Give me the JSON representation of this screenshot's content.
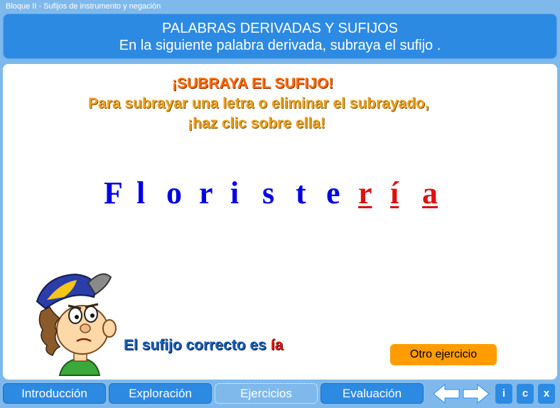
{
  "window": {
    "title": "Bloque II - Sufijos de instrumento y negación"
  },
  "header": {
    "title": "PALABRAS DERIVADAS Y SUFIJOS",
    "subtitle": "En la siguiente palabra derivada, subraya el sufijo ."
  },
  "instructions": {
    "heading": "¡SUBRAYA EL SUFIJO!",
    "line1": "Para subrayar una letra o eliminar el subrayado,",
    "line2": "¡haz clic sobre ella!"
  },
  "word": {
    "letters": [
      {
        "char": "F",
        "selected": false
      },
      {
        "char": "l",
        "selected": false
      },
      {
        "char": "o",
        "selected": false
      },
      {
        "char": "r",
        "selected": false
      },
      {
        "char": "i",
        "selected": false
      },
      {
        "char": "s",
        "selected": false
      },
      {
        "char": "t",
        "selected": false
      },
      {
        "char": "e",
        "selected": false
      },
      {
        "char": "r",
        "selected": true
      },
      {
        "char": "í",
        "selected": true
      },
      {
        "char": "a",
        "selected": true
      }
    ]
  },
  "result": {
    "label": "El sufijo correcto es",
    "suffix": "ía"
  },
  "buttons": {
    "otro": "Otro ejercicio"
  },
  "nav": {
    "tabs": [
      "Introducción",
      "Exploración",
      "Ejercicios",
      "Evaluación"
    ],
    "active": "Ejercicios",
    "small": [
      "i",
      "c",
      "x"
    ]
  },
  "icons": {
    "prev": "arrow-left-icon",
    "next": "arrow-right-icon"
  },
  "colors": {
    "accent": "#2d8ae3",
    "background": "#7fb9ec",
    "orange": "#ff9d00",
    "selected": "#e01010",
    "letter": "#0000e6"
  }
}
